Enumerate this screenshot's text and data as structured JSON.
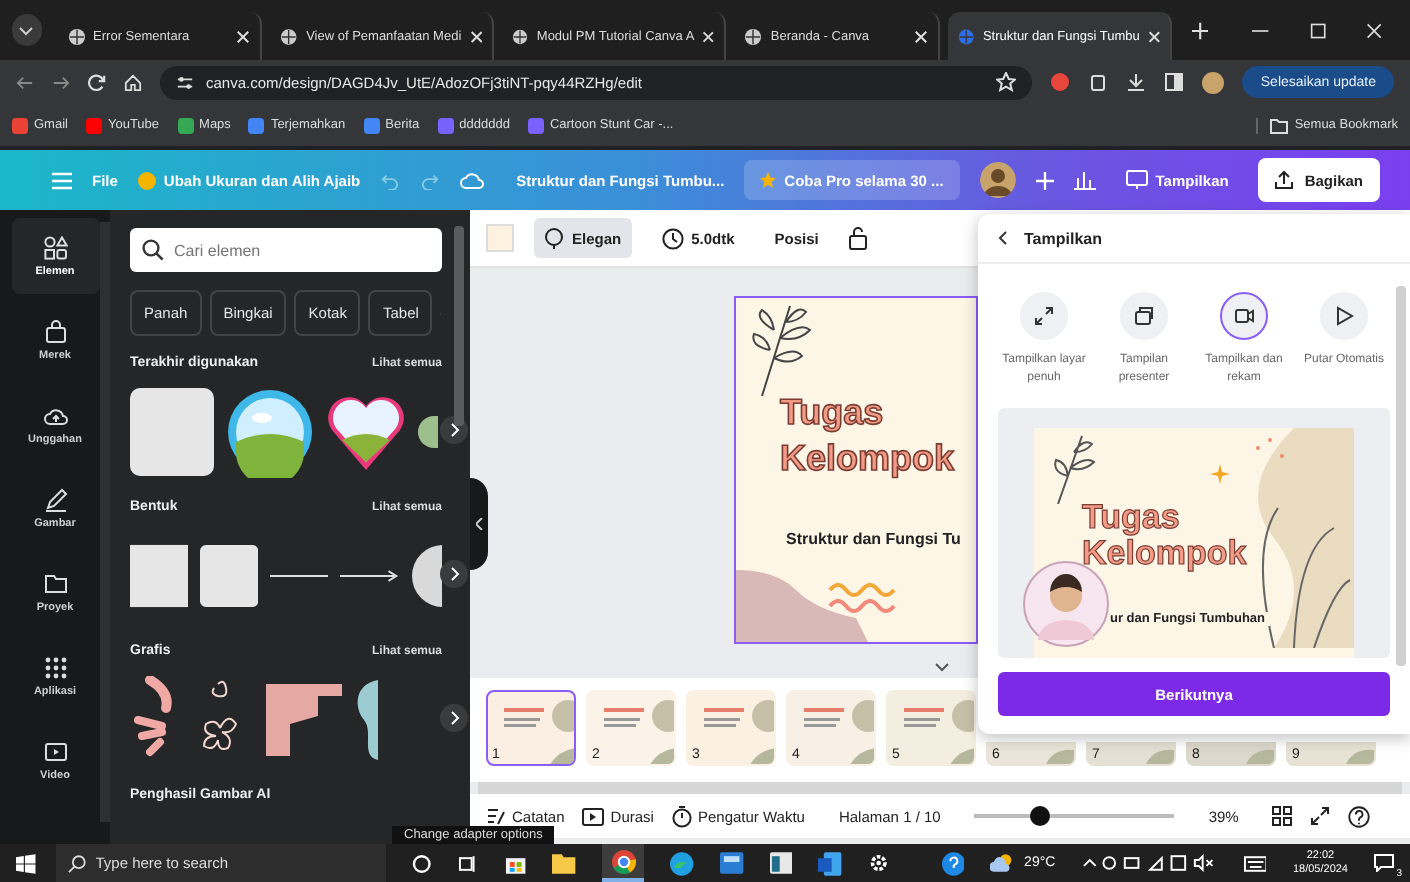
{
  "browser": {
    "tabs": [
      {
        "title": "Error Sementara",
        "selected": false
      },
      {
        "title": "View of Pemanfaatan Medi",
        "selected": false
      },
      {
        "title": "Modul PM Tutorial Canva A",
        "selected": false
      },
      {
        "title": "Beranda - Canva",
        "selected": false
      },
      {
        "title": "Struktur dan Fungsi Tumbu",
        "selected": true
      }
    ],
    "url": "canva.com/design/DAGD4Jv_UtE/AdozOFj3tiNT-pqy44RZHg/edit",
    "update_button": "Selesaikan update",
    "bookmarks": [
      "Gmail",
      "YouTube",
      "Maps",
      "Terjemahkan",
      "Berita",
      "ddddddd",
      "Cartoon Stunt Car -..."
    ],
    "all_bookmarks": "Semua Bookmark"
  },
  "editor_bar": {
    "file": "File",
    "magic": "Ubah Ukuran dan Alih Ajaib",
    "title": "Struktur dan Fungsi Tumbu...",
    "pro": "Coba Pro selama 30 ...",
    "present": "Tampilkan",
    "share": "Bagikan"
  },
  "rail": [
    {
      "label": "Elemen",
      "selected": true
    },
    {
      "label": "Merek",
      "selected": false
    },
    {
      "label": "Unggahan",
      "selected": false
    },
    {
      "label": "Gambar",
      "selected": false
    },
    {
      "label": "Proyek",
      "selected": false
    },
    {
      "label": "Aplikasi",
      "selected": false
    },
    {
      "label": "Video",
      "selected": false
    }
  ],
  "panel": {
    "search_placeholder": "Cari elemen",
    "chips": [
      "Panah",
      "Bingkai",
      "Kotak",
      "Tabel"
    ],
    "sections": [
      {
        "title": "Terakhir digunakan",
        "link": "Lihat semua"
      },
      {
        "title": "Bentuk",
        "link": "Lihat semua"
      },
      {
        "title": "Grafis",
        "link": "Lihat semua"
      },
      {
        "title": "Penghasil Gambar AI"
      }
    ]
  },
  "toolbar": {
    "style": "Elegan",
    "duration": "5.0dtk",
    "position": "Posisi"
  },
  "slide": {
    "title_lines": [
      "Tugas",
      "Kelompok"
    ],
    "subtitle": "Struktur dan Fungsi Tu"
  },
  "pages": [
    {
      "number": "1",
      "selected": true
    },
    {
      "number": "2",
      "selected": false
    },
    {
      "number": "3",
      "selected": false
    },
    {
      "number": "4",
      "selected": false
    },
    {
      "number": "5",
      "selected": false
    },
    {
      "number": "6",
      "selected": false
    },
    {
      "number": "7",
      "selected": false
    },
    {
      "number": "8",
      "selected": false
    },
    {
      "number": "9",
      "selected": false
    }
  ],
  "footer": {
    "notes": "Catatan",
    "duration": "Durasi",
    "timer": "Pengatur Waktu",
    "page": "Halaman 1 / 10",
    "zoom": {
      "level": 0.33,
      "reading": "39%"
    }
  },
  "present_panel": {
    "title": "Tampilkan",
    "options": [
      {
        "label": "Tampilkan layar penuh",
        "selected": false
      },
      {
        "label": "Tampilan presenter",
        "selected": false
      },
      {
        "label": "Tampilkan dan rekam",
        "selected": true
      },
      {
        "label": "Putar Otomatis",
        "selected": false
      }
    ],
    "preview_lines": [
      "Tugas",
      "Kelompok"
    ],
    "preview_subtitle": "ur dan Fungsi Tumbuhan",
    "next": "Berikutnya"
  },
  "tooltip": "Change adapter options",
  "taskbar": {
    "search_placeholder": "Type here to search",
    "temperature": "29°C",
    "time": "22:02",
    "date": "18/05/2024",
    "notifications": "3"
  }
}
